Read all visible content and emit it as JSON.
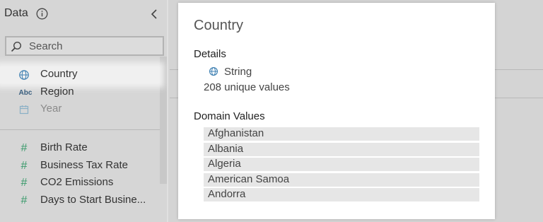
{
  "data_pane": {
    "title": "Data",
    "search_placeholder": "Search",
    "dimensions": [
      {
        "label": "Country",
        "icon": "globe-icon",
        "selected": true
      },
      {
        "label": "Region",
        "icon": "abc-icon"
      },
      {
        "label": "Year",
        "icon": "calendar-icon"
      }
    ],
    "measures": [
      {
        "label": "Birth Rate",
        "icon": "hash-icon"
      },
      {
        "label": "Business Tax Rate",
        "icon": "hash-icon"
      },
      {
        "label": "CO2 Emissions",
        "icon": "hash-icon"
      },
      {
        "label": "Days to Start Busine...",
        "icon": "hash-icon"
      }
    ],
    "abc_glyph": "Abc",
    "hash_glyph": "#"
  },
  "field_card": {
    "title": "Country",
    "details_heading": "Details",
    "data_type": "String",
    "unique_values": "208 unique values",
    "domain_heading": "Domain Values",
    "domain_values": [
      "Afghanistan",
      "Albania",
      "Algeria",
      "American Samoa",
      "Andorra"
    ]
  },
  "colors": {
    "globe_icon": "#3a7db0",
    "measure_icon": "#3a9a6b",
    "selected_row": "#f0f0f0"
  }
}
